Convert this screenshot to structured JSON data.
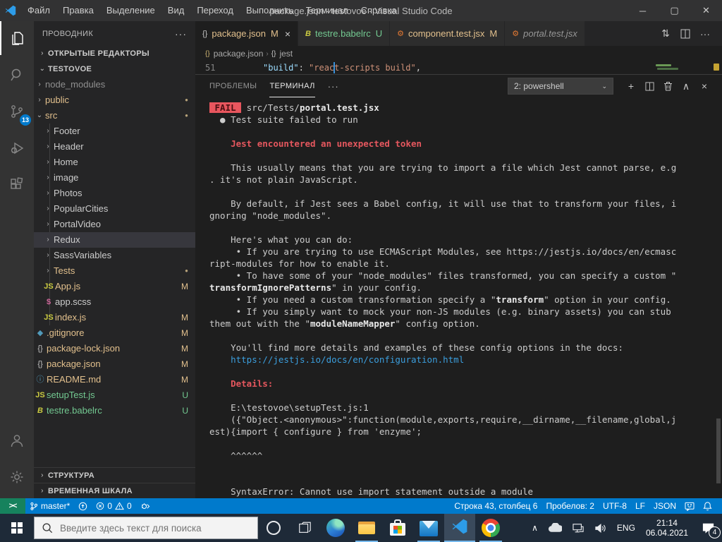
{
  "colors": {
    "accent": "#007acc",
    "remote_green": "#16825d",
    "modified": "#e2c08d",
    "untracked": "#73c991",
    "error_red": "#e5575e",
    "link_blue": "#3b9edd",
    "scm_badge_bg": "#007acc"
  },
  "window": {
    "title": "package.json - testovoe - Visual Studio Code",
    "controls": {
      "minimize": "─",
      "maximize": "▢",
      "close": "✕"
    }
  },
  "menu": {
    "items": [
      "Файл",
      "Правка",
      "Выделение",
      "Вид",
      "Переход",
      "Выполнить",
      "Терминал",
      "Справка"
    ]
  },
  "activity_bar": {
    "scm_badge": "13"
  },
  "sidebar": {
    "title": "ПРОВОДНИК",
    "more_label": "···",
    "open_editors": "ОТКРЫТЫЕ РЕДАКТОРЫ",
    "root": "TESTOVOE",
    "outline": "СТРУКТУРА",
    "timeline": "ВРЕМЕННАЯ ШКАЛА",
    "tree": [
      {
        "label": "node_modules",
        "kind": "folder",
        "depth": 1,
        "color": "dim"
      },
      {
        "label": "public",
        "kind": "folder",
        "depth": 1,
        "color": "mod",
        "dot": true
      },
      {
        "label": "src",
        "kind": "folder",
        "depth": 1,
        "color": "mod",
        "dot": true,
        "expanded": true
      },
      {
        "label": "Footer",
        "kind": "folder",
        "depth": 2
      },
      {
        "label": "Header",
        "kind": "folder",
        "depth": 2
      },
      {
        "label": "Home",
        "kind": "folder",
        "depth": 2
      },
      {
        "label": "image",
        "kind": "folder",
        "depth": 2
      },
      {
        "label": "Photos",
        "kind": "folder",
        "depth": 2
      },
      {
        "label": "PopularCities",
        "kind": "folder",
        "depth": 2
      },
      {
        "label": "PortalVideo",
        "kind": "folder",
        "depth": 2
      },
      {
        "label": "Redux",
        "kind": "folder",
        "depth": 2,
        "selected": true
      },
      {
        "label": "SassVariables",
        "kind": "folder",
        "depth": 2
      },
      {
        "label": "Tests",
        "kind": "folder",
        "depth": 2,
        "color": "mod",
        "dot": true
      },
      {
        "label": "App.js",
        "kind": "file",
        "icon": "js",
        "depth": 2,
        "badge": "M",
        "color": "mod"
      },
      {
        "label": "app.scss",
        "kind": "file",
        "icon": "scss",
        "depth": 2
      },
      {
        "label": "index.js",
        "kind": "file",
        "icon": "js",
        "depth": 2,
        "badge": "M",
        "color": "mod"
      },
      {
        "label": ".gitignore",
        "kind": "file",
        "icon": "git",
        "depth": 1,
        "badge": "M",
        "color": "mod"
      },
      {
        "label": "package-lock.json",
        "kind": "file",
        "icon": "json",
        "depth": 1,
        "badge": "M",
        "color": "mod"
      },
      {
        "label": "package.json",
        "kind": "file",
        "icon": "json",
        "depth": 1,
        "badge": "M",
        "color": "mod"
      },
      {
        "label": "README.md",
        "kind": "file",
        "icon": "info",
        "depth": 1,
        "badge": "M",
        "color": "mod"
      },
      {
        "label": "setupTest.js",
        "kind": "file",
        "icon": "js",
        "depth": 1,
        "badge": "U",
        "color": "new"
      },
      {
        "label": "testre.babelrc",
        "kind": "file",
        "icon": "babel",
        "depth": 1,
        "badge": "U",
        "color": "new"
      }
    ]
  },
  "tabs": [
    {
      "icon": "json",
      "label": "package.json",
      "badge": "M",
      "active": true,
      "decoration": "mod",
      "close": "×"
    },
    {
      "icon": "babel",
      "label": "testre.babelrc",
      "badge": "U",
      "decoration": "new"
    },
    {
      "icon": "testjsx",
      "label": "component.test.jsx",
      "badge": "M",
      "decoration": "mod"
    },
    {
      "icon": "testjsx",
      "label": "portal.test.jsx",
      "italic": true,
      "decoration": "plain"
    }
  ],
  "breadcrumb": {
    "items": [
      "package.json",
      "jest"
    ],
    "separator": "›"
  },
  "editor": {
    "line_number": "51",
    "code": {
      "key": "\"build\"",
      "sep": ": ",
      "value": "\"react-scripts build\"",
      "comma": ","
    }
  },
  "panel": {
    "problems_label": "ПРОБЛЕМЫ",
    "terminal_label": "ТЕРМИНАЛ",
    "more_label": "···",
    "shell_select": "2: powershell",
    "icons": {
      "new": "+",
      "chevron_up": "∧",
      "close": "×"
    }
  },
  "terminal_lines": [
    [
      {
        "t": " FAIL ",
        "c": "failbadge"
      },
      {
        "t": " src/Tests/"
      },
      {
        "t": "portal.test.jsx",
        "c": "b"
      }
    ],
    [
      {
        "t": "  ● Test suite failed to run"
      }
    ],
    [],
    [
      {
        "t": "    "
      },
      {
        "t": "Jest encountered an unexpected token",
        "c": "r b"
      }
    ],
    [],
    [
      {
        "t": "    This usually means that you are trying to import a file which Jest cannot parse, e.g"
      }
    ],
    [
      {
        "t": ". it's not plain JavaScript."
      }
    ],
    [],
    [
      {
        "t": "    By default, if Jest sees a Babel config, it will use that to transform your files, i"
      }
    ],
    [
      {
        "t": "gnoring \"node_modules\"."
      }
    ],
    [],
    [
      {
        "t": "    Here's what you can do:"
      }
    ],
    [
      {
        "t": "     • If you are trying to use ECMAScript Modules, see https://jestjs.io/docs/en/ecmasc"
      }
    ],
    [
      {
        "t": "ript-modules for how to enable it."
      }
    ],
    [
      {
        "t": "     • To have some of your \"node_modules\" files transformed, you can specify a custom \""
      }
    ],
    [
      {
        "t": "transformIgnorePatterns",
        "c": "b"
      },
      {
        "t": "\" in your config."
      }
    ],
    [
      {
        "t": "     • If you need a custom transformation specify a \""
      },
      {
        "t": "transform",
        "c": "b"
      },
      {
        "t": "\" option in your config."
      }
    ],
    [
      {
        "t": "     • If you simply want to mock your non-JS modules (e.g. binary assets) you can stub"
      }
    ],
    [
      {
        "t": "them out with the \""
      },
      {
        "t": "moduleNameMapper",
        "c": "b"
      },
      {
        "t": "\" config option."
      }
    ],
    [],
    [
      {
        "t": "    You'll find more details and examples of these config options in the docs:"
      }
    ],
    [
      {
        "t": "    "
      },
      {
        "t": "https://jestjs.io/docs/en/configuration.html",
        "c": "link"
      }
    ],
    [],
    [
      {
        "t": "    "
      },
      {
        "t": "Details:",
        "c": "r b"
      }
    ],
    [],
    [
      {
        "t": "    E:\\testovoe\\setupTest.js:1"
      }
    ],
    [
      {
        "t": "    ({\"Object.<anonymous>\":function(module,exports,require,__dirname,__filename,global,j"
      }
    ],
    [
      {
        "t": "est){import { configure } from 'enzyme';"
      }
    ],
    [],
    [
      {
        "t": "    ^^^^^^"
      }
    ],
    [],
    [],
    [
      {
        "t": "    SyntaxError: Cannot use import statement outside a module"
      }
    ]
  ],
  "status_bar": {
    "remote_label": "><",
    "branch": "master*",
    "errors": "0",
    "warnings": "0",
    "cursor": "Строка 43, столбец 6",
    "indent": "Пробелов: 2",
    "encoding": "UTF-8",
    "eol": "LF",
    "language": "JSON"
  },
  "taskbar": {
    "search_placeholder": "Введите здесь текст для поиска",
    "apps": [
      {
        "name": "edge",
        "running": false
      },
      {
        "name": "explorer",
        "running": true
      },
      {
        "name": "store",
        "running": false
      },
      {
        "name": "mail",
        "running": true
      },
      {
        "name": "vscode",
        "running": true,
        "active": true
      },
      {
        "name": "chrome",
        "running": true
      }
    ],
    "tray_expand": "∧",
    "language": "ENG",
    "time": "21:14",
    "date": "06.04.2021",
    "notification_count": "4"
  }
}
